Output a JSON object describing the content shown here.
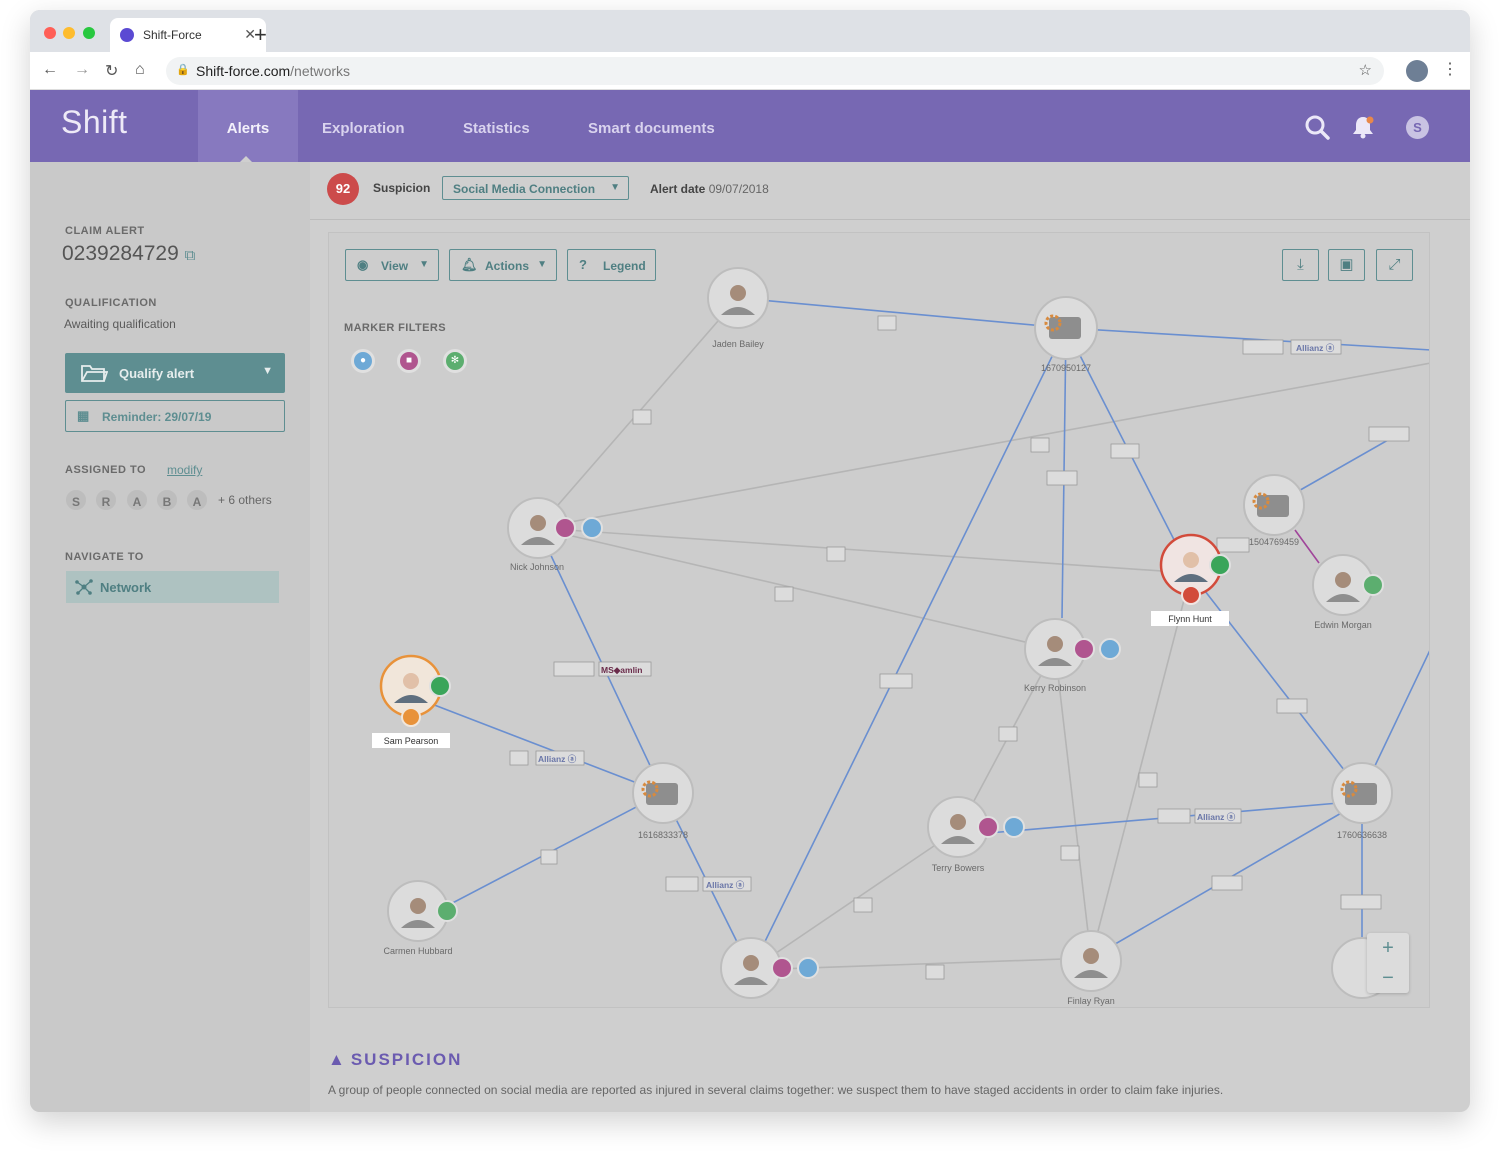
{
  "browser": {
    "tab_title": "Shift-Force",
    "url_host": "Shift-force.com",
    "url_path": "/networks"
  },
  "nav": {
    "brand": "Shift",
    "items": [
      "Alerts",
      "Exploration",
      "Statistics",
      "Smart documents"
    ],
    "user_initial": "S"
  },
  "sidebar": {
    "claim_label": "CLAIM ALERT",
    "claim_number": "0239284729",
    "qualification_label": "QUALIFICATION",
    "qualification_value": "Awaiting qualification",
    "qualify_button": "Qualify alert",
    "reminder_button": "Reminder: 29/07/19",
    "assigned_label": "ASSIGNED TO",
    "modify_link": "modify",
    "assignees": [
      "S",
      "R",
      "A",
      "B",
      "A"
    ],
    "assignees_more": "+ 6 others",
    "navigate_label": "NAVIGATE TO",
    "navigate_item": "Network"
  },
  "alert": {
    "score": "92",
    "suspicion_label": "Suspicion",
    "suspicion_value": "Social Media Connection",
    "date_label": "Alert date",
    "date_value": "09/07/2018"
  },
  "toolbar": {
    "view": "View",
    "actions": "Actions",
    "legend": "Legend"
  },
  "graph": {
    "marker_filters_label": "MARKER FILTERS",
    "nodes": [
      {
        "id": "jaden",
        "label": "Jaden Bailey",
        "kind": "person"
      },
      {
        "id": "c1670",
        "label": "1670950127",
        "kind": "claim"
      },
      {
        "id": "nick",
        "label": "Nick Johnson",
        "kind": "person"
      },
      {
        "id": "c1504",
        "label": "1504769459",
        "kind": "claim"
      },
      {
        "id": "flynn",
        "label": "Flynn Hunt",
        "kind": "person-alert"
      },
      {
        "id": "edwin",
        "label": "Edwin Morgan",
        "kind": "person"
      },
      {
        "id": "kerry",
        "label": "Kerry Robinson",
        "kind": "person"
      },
      {
        "id": "sam",
        "label": "Sam Pearson",
        "kind": "person-warning"
      },
      {
        "id": "c1616",
        "label": "1616833378",
        "kind": "claim"
      },
      {
        "id": "terry",
        "label": "Terry Bowers",
        "kind": "person"
      },
      {
        "id": "c1760",
        "label": "1760636638",
        "kind": "claim"
      },
      {
        "id": "carmen",
        "label": "Carmen Hubbard",
        "kind": "person"
      },
      {
        "id": "p10",
        "label": "",
        "kind": "person"
      },
      {
        "id": "finlay",
        "label": "Finlay Ryan",
        "kind": "person"
      },
      {
        "id": "p12",
        "label": "",
        "kind": "person"
      }
    ],
    "insurer_labels": [
      "Allianz",
      "MS amlin"
    ]
  },
  "suspicion": {
    "title": "SUSPICION",
    "text": "A group of people connected on social media are reported as injured in several claims together: we suspect them to have staged accidents in order to claim fake injuries."
  },
  "colors": {
    "brand": "#7768b3",
    "accent": "#5e8e91",
    "score": "#cc4b4b",
    "edge_blue": "#6a8fd0",
    "edge_gray": "#b0b0b0"
  }
}
